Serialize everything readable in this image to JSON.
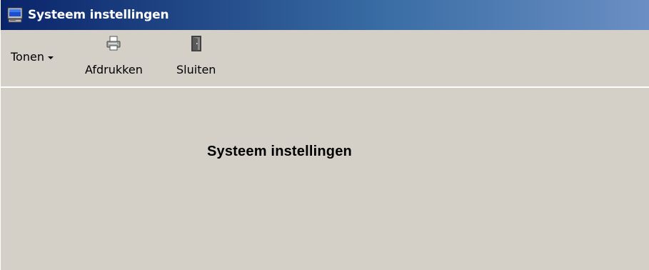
{
  "window": {
    "title": "Systeem instellingen",
    "title_icon": "computer-monitor-icon",
    "titlebar_colors": [
      "#0a246a",
      "#3a6ea5",
      "#6b8fc4"
    ]
  },
  "toolbar": {
    "dropdown_label": "Tonen",
    "print_label": "Afdrukken",
    "print_icon": "printer-icon",
    "close_label": "Sluiten",
    "close_icon": "door-exit-icon"
  },
  "main": {
    "heading": "Systeem instellingen"
  },
  "colors": {
    "panel_background": "#d4d0c8",
    "text": "#000000"
  }
}
